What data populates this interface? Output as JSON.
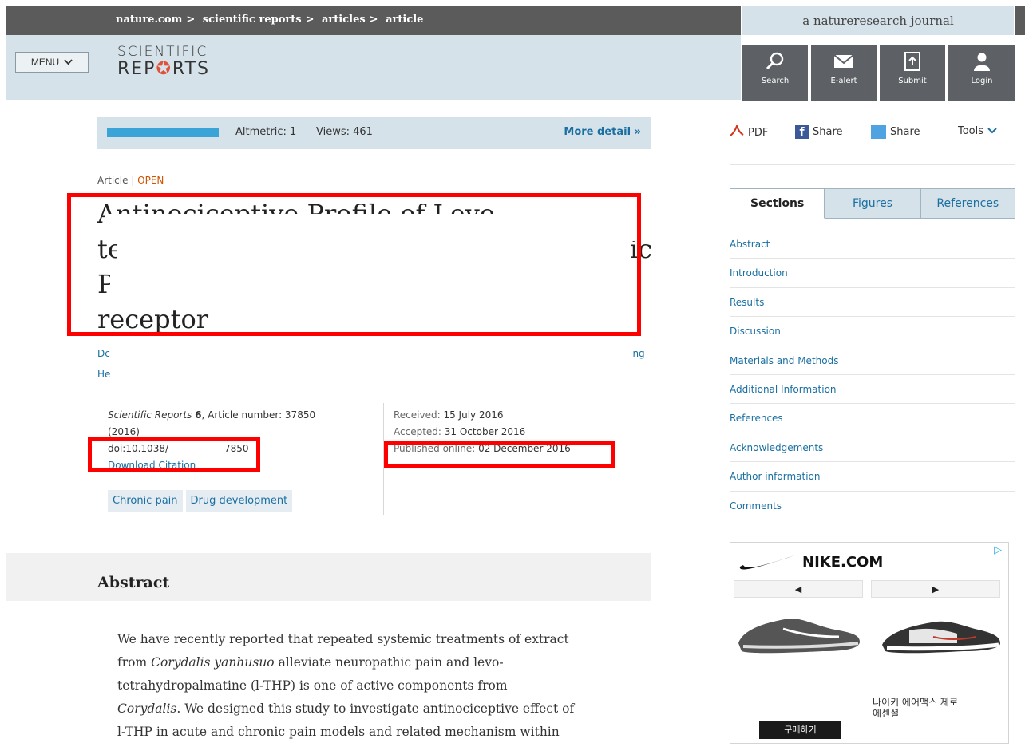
{
  "topbar": {
    "breadcrumb": [
      "nature.com",
      "scientific reports",
      "articles",
      "article"
    ],
    "separator": ">",
    "journal_tag": "a natureresearch journal"
  },
  "header": {
    "menu_label": "MENU",
    "logo_line1": "SCIENTIFIC",
    "logo_line2_a": "REP",
    "logo_line2_b": "RTS",
    "icons": [
      {
        "label": "Search",
        "icon": "search-icon"
      },
      {
        "label": "E-alert",
        "icon": "envelope-icon"
      },
      {
        "label": "Submit",
        "icon": "upload-icon"
      },
      {
        "label": "Login",
        "icon": "user-icon"
      }
    ]
  },
  "metrics": {
    "altmetric": "Altmetric: 1",
    "views": "Views: 461",
    "more_detail": "More detail"
  },
  "article": {
    "type": "Article",
    "access": "OPEN",
    "title_lines": [
      "Antinociceptive Profile of Levo-",
      "te",
      "P",
      "receptor"
    ],
    "title_right_fragment": "ic",
    "author_line1": "Dc",
    "author_line1_end": "ng-",
    "author_line2": "He",
    "journal": "Scientific Reports",
    "volume": "6",
    "article_number_label": ", Article number: 37850",
    "year": "(2016)",
    "doi_prefix": "doi:10.1038/",
    "doi_suffix": "7850",
    "download_citation": "Download Citation",
    "received_label": "Received:",
    "received": "15 July 2016",
    "accepted_label": "Accepted:",
    "accepted": "31 October 2016",
    "published_label": "Published online:",
    "published": "02 December 2016",
    "tags": [
      "Chronic pain",
      "Drug development"
    ]
  },
  "abstract": {
    "heading": "Abstract",
    "lines": [
      [
        "We have recently reported that repeated systemic treatments of extract"
      ],
      [
        "from ",
        {
          "i": "Corydalis yanhusuo"
        },
        " alleviate neuropathic pain and levo-"
      ],
      [
        "tetrahydropalmatine (l-THP) is one of active components from"
      ],
      [
        {
          "i": "Corydalis"
        },
        ". We designed this study to investigate antinociceptive effect of"
      ],
      [
        "l-THP in acute and chronic pain models and related mechanism within"
      ]
    ]
  },
  "sidebar": {
    "pdf": "PDF",
    "share1": "Share",
    "share2": "Share",
    "tools": "Tools",
    "tabs": [
      "Sections",
      "Figures",
      "References"
    ],
    "sections": [
      "Abstract",
      "Introduction",
      "Results",
      "Discussion",
      "Materials and Methods",
      "Additional Information",
      "References",
      "Acknowledgements",
      "Author information",
      "Comments"
    ]
  },
  "ad": {
    "brand": "NIKE.COM",
    "product": "나이키 에어맥스 제로\n에센셜",
    "buy": "구매하기",
    "prev": "◀",
    "next": "▶"
  },
  "colors": {
    "topbar": "#5b5b5b",
    "header_band": "#d5e2ea",
    "link": "#1a6fa1",
    "open_badge": "#d35400",
    "redaction": "#ff0000"
  }
}
